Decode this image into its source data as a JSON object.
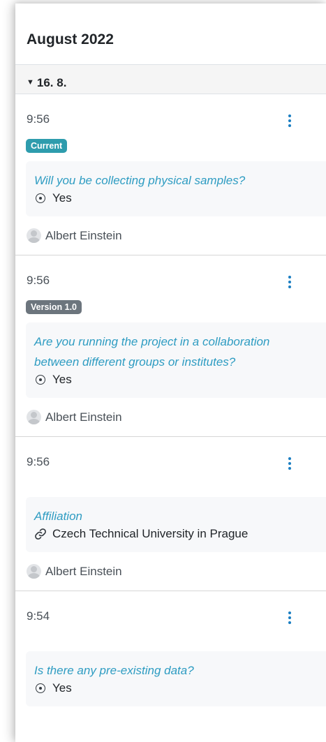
{
  "header": {
    "month": "August 2022"
  },
  "day": {
    "label": "16. 8."
  },
  "events": [
    {
      "time": "9:56",
      "badge": "Current",
      "question": "Will you be collecting physical samples?",
      "answer": "Yes",
      "answer_icon": "radio-selected-icon",
      "author": "Albert Einstein"
    },
    {
      "time": "9:56",
      "badge": "Version 1.0",
      "question": "Are you running the project in a collaboration between different groups or institutes?",
      "answer": "Yes",
      "answer_icon": "radio-selected-icon",
      "author": "Albert Einstein"
    },
    {
      "time": "9:56",
      "question": "Affiliation",
      "answer": "Czech Technical University in Prague",
      "answer_icon": "link-icon",
      "author": "Albert Einstein"
    },
    {
      "time": "9:54",
      "question": "Is there any pre-existing data?",
      "answer": "Yes",
      "answer_icon": "radio-selected-icon"
    }
  ],
  "colors": {
    "accent": "#2e9cc2",
    "badge_current": "#2e9cad",
    "badge_version": "#6c757d",
    "menu": "#1a7ec2"
  }
}
